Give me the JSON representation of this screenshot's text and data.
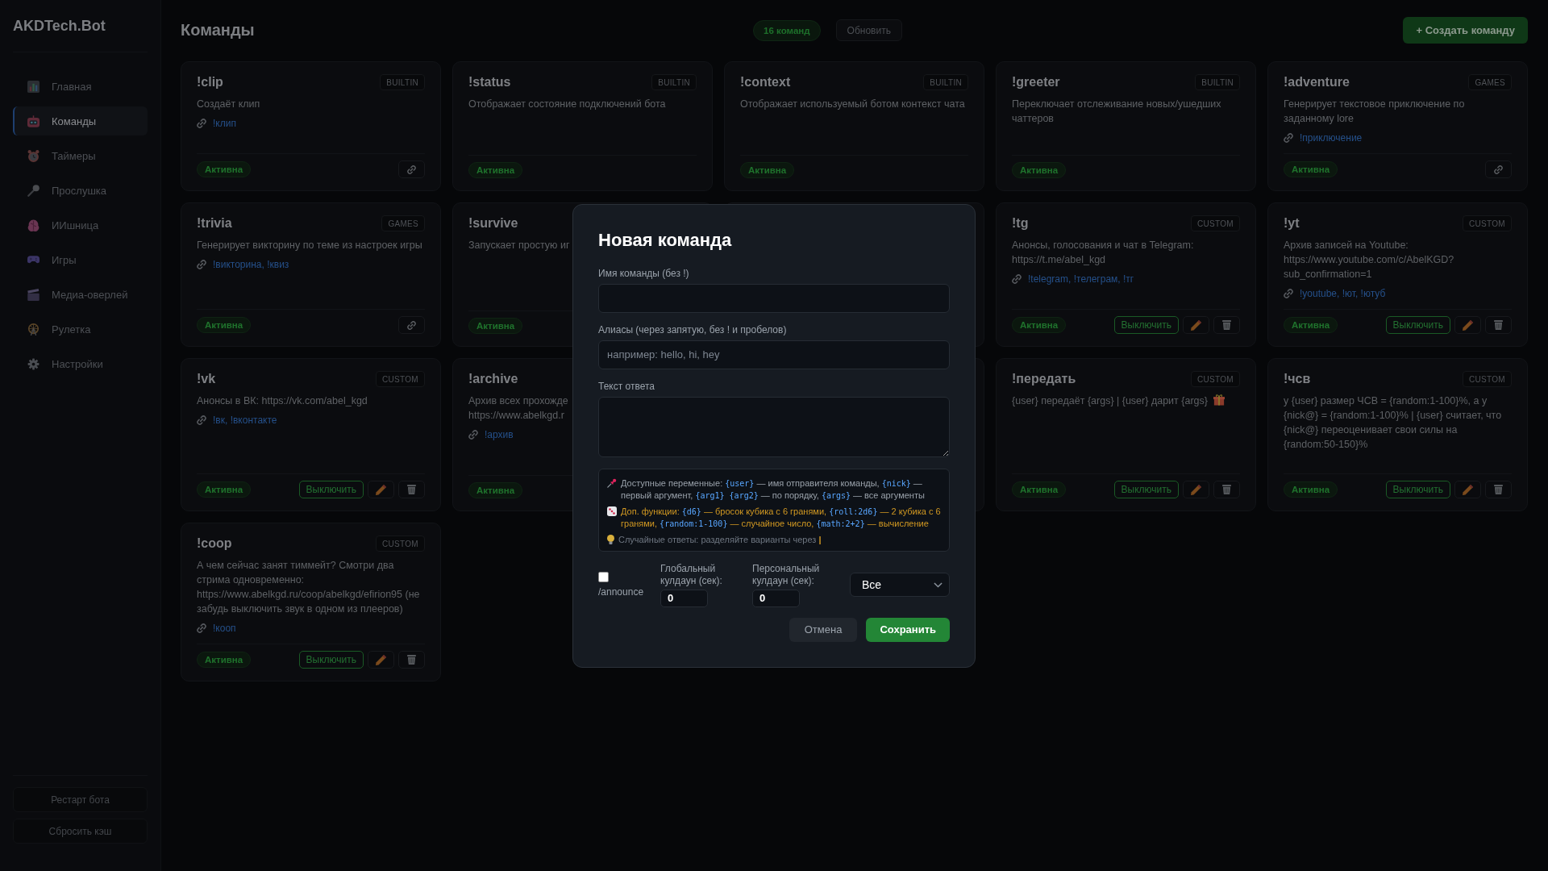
{
  "sidebar": {
    "logo": "AKDTech.Bot",
    "items": [
      {
        "label": "Главная",
        "selected": false
      },
      {
        "label": "Команды",
        "selected": true
      },
      {
        "label": "Таймеры",
        "selected": false
      },
      {
        "label": "Прослушка",
        "selected": false
      },
      {
        "label": "ИИшница",
        "selected": false
      },
      {
        "label": "Игры",
        "selected": false
      },
      {
        "label": "Медиа-оверлей",
        "selected": false
      },
      {
        "label": "Рулетка",
        "selected": false
      },
      {
        "label": "Настройки",
        "selected": false
      }
    ],
    "footer_buttons": [
      "Рестарт бота",
      "Сбросить кэш"
    ]
  },
  "header": {
    "title": "Команды",
    "count": "16 команд",
    "refresh_button": "Обновить",
    "create_button": "+ Создать команду"
  },
  "commands": [
    {
      "name": "!clip",
      "category": "BUILTIN",
      "description": "Создаёт клип",
      "aliases": "!клип",
      "status": "Активна",
      "actions": [
        {
          "kind": "link"
        }
      ]
    },
    {
      "name": "!status",
      "category": "BUILTIN",
      "description": "Отображает состояние подключений бота",
      "status": "Активна"
    },
    {
      "name": "!context",
      "category": "BUILTIN",
      "description": "Отображает используемый ботом контекст чата",
      "status": "Активна"
    },
    {
      "name": "!greeter",
      "category": "BUILTIN",
      "description": "Переключает отслеживание новых/ушедших чаттеров",
      "status": "Активна"
    },
    {
      "name": "!adventure",
      "category": "GAMES",
      "description": "Генерирует текстовое приключение по заданному lore",
      "aliases": "!приключение",
      "status": "Активна",
      "actions": [
        {
          "kind": "link"
        }
      ]
    },
    {
      "name": "!trivia",
      "category": "GAMES",
      "description": "Генерирует викторину по теме из настроек игры",
      "aliases": "!викторина, !квиз",
      "status": "Активна",
      "actions": [
        {
          "kind": "link"
        }
      ]
    },
    {
      "name": "!survive",
      "description": "Запускает простую иг",
      "status": "Активна"
    },
    {
      "name": "!tg",
      "category": "CUSTOM",
      "description": "Анонсы, голосования и чат в Telegram: https://t.me/abel_kgd",
      "aliases": "!telegram, !телеграм, !тг",
      "status": "Активна",
      "actions": [
        {
          "kind": "toggle",
          "label": "Выключить"
        },
        {
          "kind": "edit"
        },
        {
          "kind": "delete"
        }
      ]
    },
    {
      "name": "!yt",
      "category": "CUSTOM",
      "description": "Архив записей на Youtube: https://www.youtube.com/c/AbelKGD?sub_confirmation=1",
      "aliases": "!youtube, !ют, !ютуб",
      "status": "Активна",
      "actions": [
        {
          "kind": "toggle",
          "label": "Выключить"
        },
        {
          "kind": "edit"
        },
        {
          "kind": "delete"
        }
      ]
    },
    {
      "name": "!vk",
      "category": "CUSTOM",
      "description": "Анонсы в ВК: https://vk.com/abel_kgd",
      "aliases": "!вк, !вконтакте",
      "status": "Активна",
      "actions": [
        {
          "kind": "toggle",
          "label": "Выключить"
        },
        {
          "kind": "edit"
        },
        {
          "kind": "delete"
        }
      ]
    },
    {
      "name": "!archive",
      "description": "Архив всех прохожде\nhttps://www.abelkgd.r",
      "aliases": "!архив",
      "status": "Активна"
    },
    {
      "name": "!передать",
      "category": "CUSTOM",
      "description": "{user} передаёт {args} | {user} дарит {args}",
      "gift_icon": true,
      "status": "Активна",
      "actions": [
        {
          "kind": "toggle",
          "label": "Выключить"
        },
        {
          "kind": "edit"
        },
        {
          "kind": "delete"
        }
      ]
    },
    {
      "name": "!чсв",
      "category": "CUSTOM",
      "description": "у {user} размер ЧСВ = {random:1-100}%, а у {nick@} = {random:1-100}% | {user} считает, что {nick@} переоценивает свои силы на {random:50-150}%",
      "status": "Активна",
      "actions": [
        {
          "kind": "toggle",
          "label": "Выключить"
        },
        {
          "kind": "edit"
        },
        {
          "kind": "delete"
        }
      ]
    },
    {
      "name": "!coop",
      "category": "CUSTOM",
      "description": "А чем сейчас занят тиммейт? Смотри два стрима одновременно: https://www.abelkgd.ru/coop/abelkgd/efirion95 (не забудь выключить звук в одном из плееров)",
      "aliases": "!кооп",
      "status": "Активна",
      "actions": [
        {
          "kind": "toggle",
          "label": "Выключить"
        },
        {
          "kind": "edit"
        },
        {
          "kind": "delete"
        }
      ]
    }
  ],
  "modal": {
    "title": "Новая команда",
    "fields": [
      {
        "kind": "input",
        "label": "Имя команды (без !)"
      },
      {
        "kind": "input",
        "label": "Алиасы (через запятую, без ! и пробелов)",
        "placeholder": "например: hello, hi, hey"
      },
      {
        "kind": "textarea",
        "label": "Текст ответа"
      }
    ],
    "hints": [
      {
        "kind": "variables",
        "parts": [
          {
            "kind": "text",
            "text": "Доступные переменные: "
          },
          {
            "kind": "code",
            "text": "{user}"
          },
          {
            "kind": "text",
            "text": " — имя отправителя команды, "
          },
          {
            "kind": "code",
            "text": "{nick}"
          },
          {
            "kind": "text",
            "text": " — первый аргумент, "
          },
          {
            "kind": "code",
            "text": "{arg1} {arg2}"
          },
          {
            "kind": "text",
            "text": " — по порядку, "
          },
          {
            "kind": "code",
            "text": "{args}"
          },
          {
            "kind": "text",
            "text": " — все аргументы"
          }
        ]
      },
      {
        "kind": "functions",
        "parts": [
          {
            "kind": "text",
            "text": "Доп. функции: "
          },
          {
            "kind": "code",
            "text": "{d6}"
          },
          {
            "kind": "text",
            "text": " — бросок кубика с 6 гранями, "
          },
          {
            "kind": "code",
            "text": "{roll:2d6}"
          },
          {
            "kind": "text",
            "text": " — 2 кубика с 6 гранями, "
          },
          {
            "kind": "code",
            "text": "{random:1-100}"
          },
          {
            "kind": "text",
            "text": " — случайное число, "
          },
          {
            "kind": "code",
            "text": "{math:2+2}"
          },
          {
            "kind": "text",
            "text": " — вычисление"
          }
        ]
      },
      {
        "kind": "tip",
        "parts": [
          {
            "kind": "text",
            "text": "Случайные ответы: разделяйте варианты через "
          },
          {
            "kind": "accent",
            "text": "|"
          }
        ]
      }
    ],
    "announce": {
      "label": "/announce",
      "checked": false
    },
    "cooldowns": [
      {
        "label": "Глобальный кулдаун (сек):",
        "value": "0"
      },
      {
        "label": "Персональный кулдаун (сек):",
        "value": "0"
      }
    ],
    "audience_select": {
      "value": "Все"
    },
    "buttons": [
      {
        "kind": "secondary",
        "label": "Отмена"
      },
      {
        "kind": "primary",
        "label": "Сохранить"
      }
    ]
  }
}
